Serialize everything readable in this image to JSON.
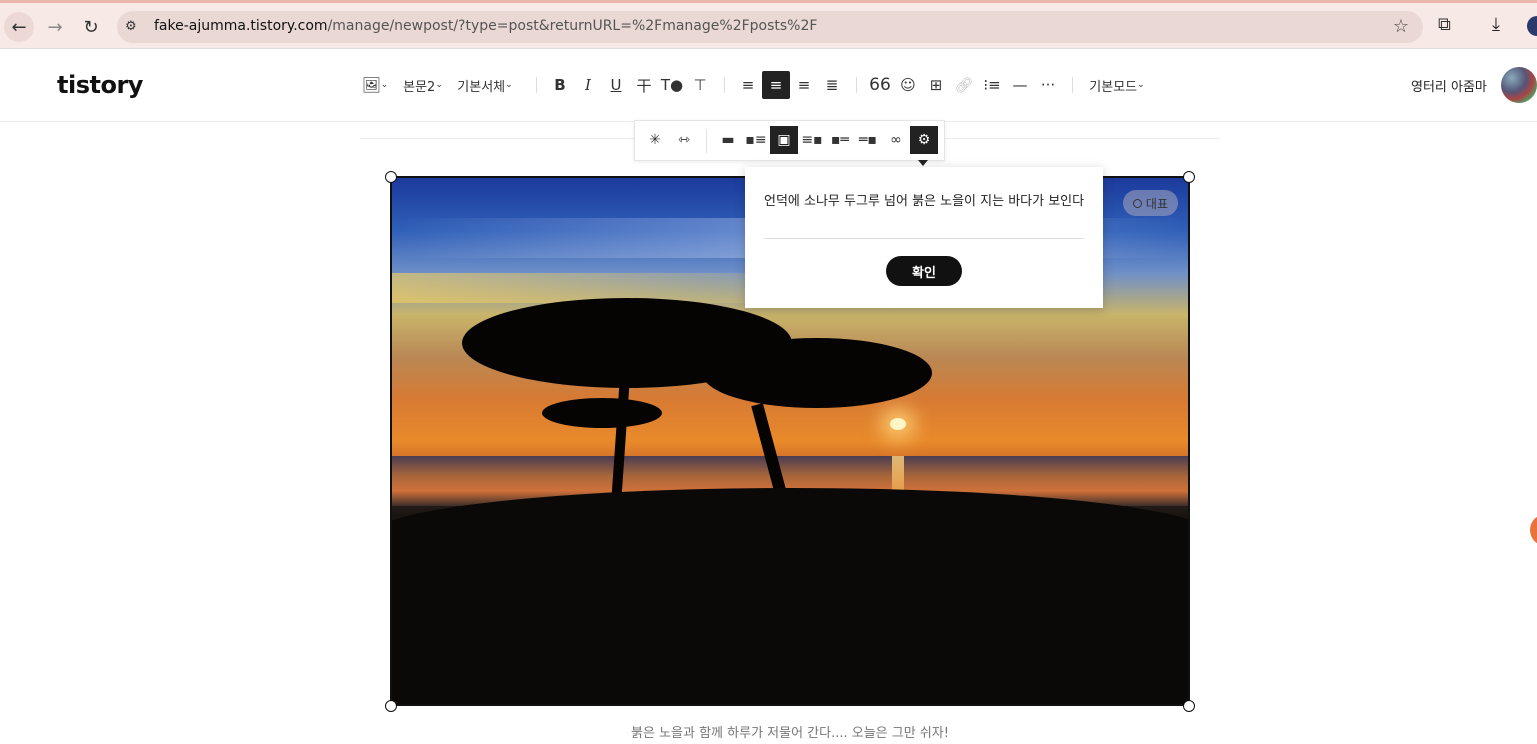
{
  "browser": {
    "url_host": "fake-ajumma.tistory.com",
    "url_path": "/manage/newpost/?type=post&returnURL=%2Fmanage%2Fposts%2F"
  },
  "header": {
    "logo": "tistory",
    "toolbar": {
      "paragraph_style": "본문2",
      "font": "기본서체",
      "mode": "기본모드"
    },
    "user_name": "영터리 아줌마"
  },
  "image": {
    "representative_badge": "대표",
    "caption": "붉은 노을과 함께 하루가 저물어 간다....  오늘은 그만 쉬자!"
  },
  "caption_popup": {
    "value": "언덕에 소나무 두그루 넘어 붉은 노을이 지는 바다가 보인다",
    "confirm_label": "확인"
  }
}
